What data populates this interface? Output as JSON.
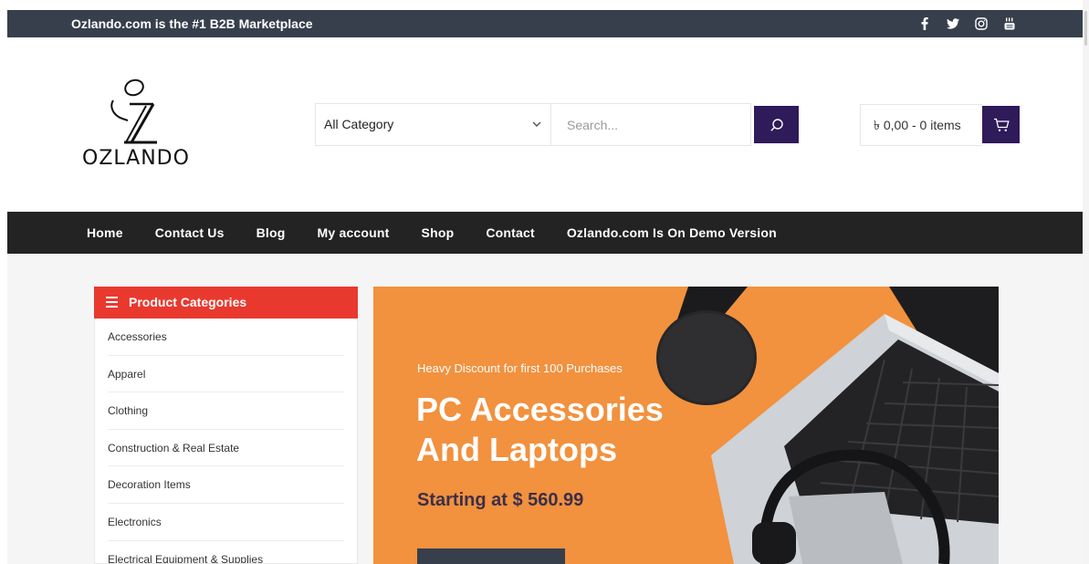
{
  "topbar": {
    "promo": "Ozlando.com is the #1 B2B Marketplace",
    "social": [
      "facebook-icon",
      "twitter-icon",
      "instagram-icon",
      "youtube-icon"
    ],
    "bg": "#373f4c"
  },
  "header": {
    "logo_text": "OZLANDO",
    "category_select": "All Category",
    "search_placeholder": "Search...",
    "cart_summary": "৳ 0,00 - 0 items",
    "accent": "#2f1a5a"
  },
  "nav": {
    "items": [
      "Home",
      "Contact Us",
      "Blog",
      "My account",
      "Shop",
      "Contact",
      "Ozlando.com Is On Demo Version"
    ]
  },
  "sidebar": {
    "title": "Product Categories",
    "accent": "#e9392f",
    "items": [
      "Accessories",
      "Apparel",
      "Clothing",
      "Construction & Real Estate",
      "Decoration Items",
      "Electronics",
      "Electrical Equipment & Supplies"
    ]
  },
  "hero": {
    "subtitle": "Heavy Discount for first 100 Purchases",
    "title": "PC Accessories And Laptops",
    "price": "Starting at $ 560.99",
    "bg": "#f2913e"
  }
}
